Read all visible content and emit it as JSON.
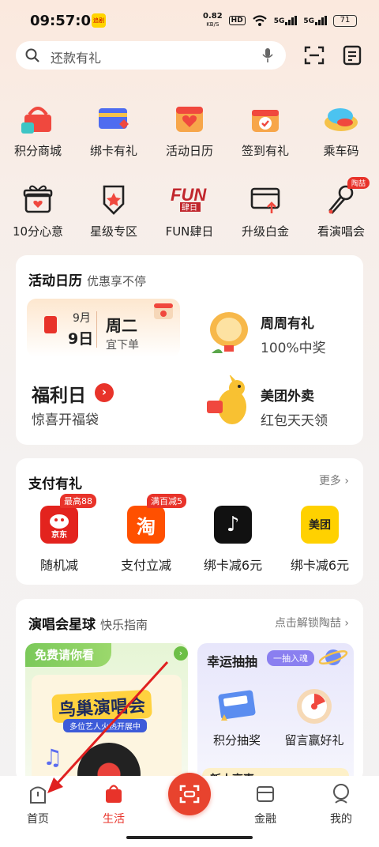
{
  "status": {
    "time": "09:57:03",
    "app_badge": "追剧",
    "net_speed": "0.82",
    "net_unit": "KB/S",
    "hd": "HD",
    "sig1": "5G",
    "sig2": "5G",
    "battery": "71"
  },
  "search": {
    "placeholder": "还款有礼"
  },
  "grid": {
    "row1": [
      {
        "label": "积分商城",
        "icon": "shopping-basket-icon"
      },
      {
        "label": "绑卡有礼",
        "icon": "bank-card-icon"
      },
      {
        "label": "活动日历",
        "icon": "calendar-heart-icon"
      },
      {
        "label": "签到有礼",
        "icon": "checkin-gift-icon"
      },
      {
        "label": "乘车码",
        "icon": "bus-code-icon"
      }
    ],
    "row2": [
      {
        "label": "10分心意",
        "icon": "gift-box-icon"
      },
      {
        "label": "星级专区",
        "icon": "star-medal-icon"
      },
      {
        "label": "FUN肆日",
        "icon": "fun-logo-icon",
        "logo_text": "FUN",
        "logo_sub": "肆日"
      },
      {
        "label": "升级白金",
        "icon": "card-upgrade-icon"
      },
      {
        "label": "看演唱会",
        "icon": "microphone-icon",
        "badge": "陶喆"
      }
    ]
  },
  "calendar_card": {
    "title": "活动日历",
    "subtitle": "优惠享不停",
    "month": "9月",
    "day": "9日",
    "weekday": "周二",
    "hint": "宜下单",
    "promo1_title": "周周有礼",
    "promo1_sub": "100%中奖",
    "welfare_title": "福利日",
    "welfare_arrow": "›",
    "welfare_sub": "惊喜开福袋",
    "promo2_title": "美团外卖",
    "promo2_sub": "红包天天领"
  },
  "pay_card": {
    "title": "支付有礼",
    "more": "更多 ›",
    "items": [
      {
        "label": "随机减",
        "badge": "最高88",
        "logo": "京东",
        "color": "#e3231e"
      },
      {
        "label": "支付立减",
        "badge": "满百减5",
        "logo": "淘",
        "color": "#ff5000"
      },
      {
        "label": "绑卡减6元",
        "badge": "",
        "logo": "♪",
        "color": "#111111"
      },
      {
        "label": "绑卡减6元",
        "badge": "",
        "logo": "美团",
        "color": "#ffd100"
      }
    ]
  },
  "concert_card": {
    "title": "演唱会星球",
    "subtitle": "快乐指南",
    "unlock": "点击解锁陶喆 ›",
    "free_banner": "免费请你看",
    "bird_title": "鸟巢演唱会",
    "bird_sub": "多位艺人火热开展中",
    "lucky_title": "幸运抽抽",
    "lucky_tag": "一抽入魂",
    "lucky_item1": "积分抽奖",
    "lucky_item2": "留言赢好礼",
    "newbie": "新人享喜"
  },
  "tabbar": {
    "home": "首页",
    "life": "生活",
    "finance": "金融",
    "mine": "我的"
  },
  "colors": {
    "accent": "#e8332a"
  }
}
